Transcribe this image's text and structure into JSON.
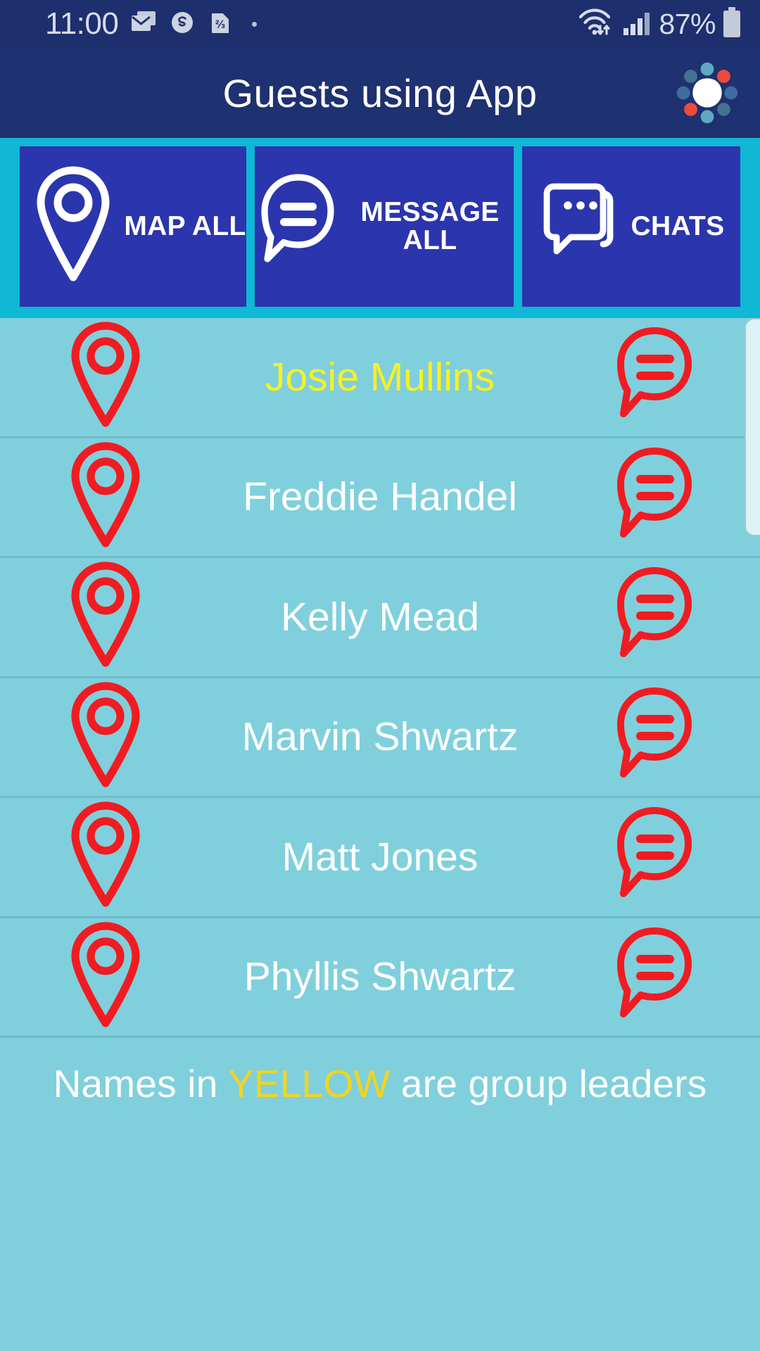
{
  "status_bar": {
    "clock": "11:00",
    "battery_percent": "87%",
    "icons": [
      "envelope-icon",
      "skype-icon",
      "sim-card-icon",
      "dot-icon",
      "wifi-icon",
      "cellular-signal-icon",
      "battery-icon"
    ]
  },
  "app_bar": {
    "title": "Guests using App",
    "logo": "app-logo-icon"
  },
  "action_bar": {
    "buttons": [
      {
        "label": "MAP ALL",
        "icon": "map-pin-icon"
      },
      {
        "label": "MESSAGE ALL",
        "icon": "message-bubble-icon"
      },
      {
        "label": "CHATS",
        "icon": "chats-icon"
      }
    ]
  },
  "guest_list": {
    "rows": [
      {
        "name": "Josie Mullins",
        "is_leader": true,
        "pin_icon": "map-pin-icon",
        "chat_icon": "chat-bubble-icon"
      },
      {
        "name": "Freddie Handel",
        "is_leader": false,
        "pin_icon": "map-pin-icon",
        "chat_icon": "chat-bubble-icon"
      },
      {
        "name": "Kelly Mead",
        "is_leader": false,
        "pin_icon": "map-pin-icon",
        "chat_icon": "chat-bubble-icon"
      },
      {
        "name": "Marvin Shwartz",
        "is_leader": false,
        "pin_icon": "map-pin-icon",
        "chat_icon": "chat-bubble-icon"
      },
      {
        "name": "Matt Jones",
        "is_leader": false,
        "pin_icon": "map-pin-icon",
        "chat_icon": "chat-bubble-icon"
      },
      {
        "name": "Phyllis Shwartz",
        "is_leader": false,
        "pin_icon": "map-pin-icon",
        "chat_icon": "chat-bubble-icon"
      }
    ]
  },
  "footer": {
    "prefix": "Names in ",
    "highlight": "YELLOW",
    "suffix": " are group leaders"
  },
  "colors": {
    "status_bar_bg": "#1e2f6e",
    "app_bar_bg": "#1e3170",
    "action_bar_bg": "#0fb8d4",
    "action_button_bg": "#2b35ad",
    "list_bg": "#7fd0dc",
    "row_divider": "#6cbcc6",
    "icon_red": "#f01c22",
    "leader_yellow": "#f9f025",
    "footer_highlight": "#f4d41c",
    "text_white": "#ffffff"
  }
}
